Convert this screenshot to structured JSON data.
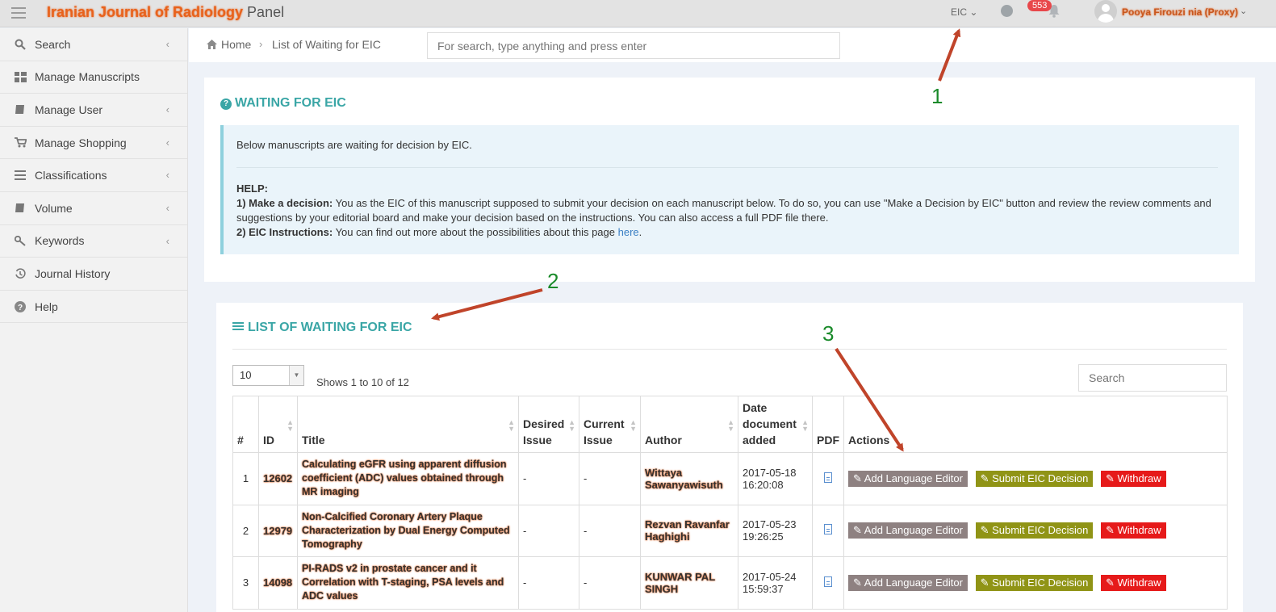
{
  "header": {
    "title_redacted": "Iranian Journal of Radiology",
    "title_suffix": "Panel",
    "role": "EIC",
    "notification_count": "553",
    "user_name_redacted": "Pooya Firouzi nia (Proxy)"
  },
  "sidebar": {
    "items": [
      {
        "label": "Search",
        "icon": "search-icon",
        "chevron": true
      },
      {
        "label": "Manage Manuscripts",
        "icon": "grid-icon",
        "chevron": false
      },
      {
        "label": "Manage User",
        "icon": "book-icon",
        "chevron": true
      },
      {
        "label": "Manage Shopping",
        "icon": "cart-icon",
        "chevron": true
      },
      {
        "label": "Classifications",
        "icon": "list-icon",
        "chevron": true
      },
      {
        "label": "Volume",
        "icon": "book-icon",
        "chevron": true
      },
      {
        "label": "Keywords",
        "icon": "key-icon",
        "chevron": true
      },
      {
        "label": "Journal History",
        "icon": "history-icon",
        "chevron": false
      },
      {
        "label": "Help",
        "icon": "question-icon",
        "chevron": false
      }
    ]
  },
  "breadcrumb": {
    "home": "Home",
    "current": "List of Waiting for EIC"
  },
  "global_search": {
    "placeholder": "For search, type anything and press enter"
  },
  "info_panel": {
    "title": "WAITING FOR EIC",
    "intro": "Below manuscripts are waiting for decision by EIC.",
    "help_label": "HELP:",
    "item1_label": "1) Make a decision:",
    "item1_text": "You as the EIC of this manuscript supposed to submit your decision on each manuscript below. To do so, you can use \"Make a Decision by EIC\" button and review the review comments and suggestions by your editorial board and make your decision based on the instructions. You can also access a full PDF file there.",
    "item2_label": "2) EIC Instructions:",
    "item2_text": "You can find out more about the possibilities about this page",
    "item2_link": "here"
  },
  "annotations": {
    "one": "1",
    "two": "2",
    "three": "3"
  },
  "list_panel": {
    "title": "LIST OF WAITING FOR EIC",
    "page_size": "10",
    "shows_text": "Shows 1 to 10 of 12",
    "search_placeholder": "Search",
    "columns": {
      "num": "#",
      "id": "ID",
      "title": "Title",
      "desired_issue": "Desired Issue",
      "current_issue": "Current Issue",
      "author": "Author",
      "date_added": "Date document added",
      "pdf": "PDF",
      "actions": "Actions"
    },
    "rows": [
      {
        "num": "1",
        "id": "12602",
        "title": "Calculating eGFR using apparent diffusion coefficient (ADC) values obtained through MR imaging",
        "desired_issue": "-",
        "current_issue": "-",
        "author": "Wittaya Sawanyawisuth",
        "date": "2017-05-18 16:20:08"
      },
      {
        "num": "2",
        "id": "12979",
        "title": "Non-Calcified Coronary Artery Plaque Characterization by Dual Energy Computed Tomography",
        "desired_issue": "-",
        "current_issue": "-",
        "author": "Rezvan Ravanfar Haghighi",
        "date": "2017-05-23 19:26:25"
      },
      {
        "num": "3",
        "id": "14098",
        "title": "PI-RADS v2 in prostate cancer and it Correlation with T-staging, PSA levels and ADC values",
        "desired_issue": "-",
        "current_issue": "-",
        "author": "KUNWAR PAL SINGH",
        "date": "2017-05-24 15:59:37"
      }
    ],
    "actions": {
      "add_editor": "Add Language Editor",
      "submit_decision": "Submit EIC Decision",
      "withdraw": "Withdraw"
    }
  },
  "colors": {
    "accent_teal": "#3aa6a6",
    "annotation_green": "#1a8a2a",
    "arrow_red": "#c0442a",
    "btn_gray": "#8e8181",
    "btn_olive": "#909416",
    "btn_red": "#e61a1a"
  }
}
